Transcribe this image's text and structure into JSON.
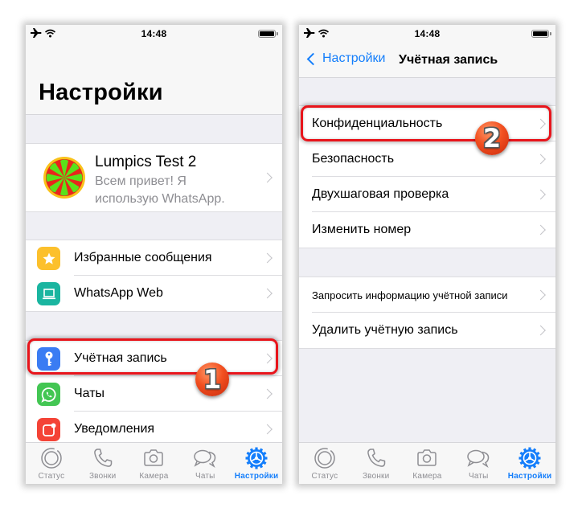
{
  "status_bar": {
    "time": "14:48",
    "icons": [
      "airplane-icon",
      "wifi-icon",
      "battery-icon"
    ]
  },
  "phone1": {
    "title": "Настройки",
    "profile": {
      "name": "Lumpics Test 2",
      "status": "Всем привет! Я использую WhatsApp."
    },
    "group1": [
      {
        "label": "Избранные сообщения",
        "icon": "star-icon",
        "color": "#fcc02c"
      },
      {
        "label": "WhatsApp Web",
        "icon": "laptop-icon",
        "color": "#1ab5a0"
      }
    ],
    "group2": [
      {
        "label": "Учётная запись",
        "icon": "key-icon",
        "color": "#3a7cf3"
      },
      {
        "label": "Чаты",
        "icon": "whatsapp-icon",
        "color": "#43c653"
      },
      {
        "label": "Уведомления",
        "icon": "notification-icon",
        "color": "#f44336"
      }
    ],
    "step_badge": "1"
  },
  "phone2": {
    "back_label": "Настройки",
    "title": "Учётная запись",
    "group1": [
      {
        "label": "Конфиденциальность"
      },
      {
        "label": "Безопасность"
      },
      {
        "label": "Двухшаговая проверка"
      },
      {
        "label": "Изменить номер"
      }
    ],
    "group2": [
      {
        "label": "Запросить информацию учётной записи"
      },
      {
        "label": "Удалить учётную запись"
      }
    ],
    "step_badge": "2"
  },
  "tabbar": {
    "tabs": [
      {
        "label": "Статус",
        "icon": "status-icon",
        "active": false
      },
      {
        "label": "Звонки",
        "icon": "phone-icon",
        "active": false
      },
      {
        "label": "Камера",
        "icon": "camera-icon",
        "active": false
      },
      {
        "label": "Чаты",
        "icon": "chats-icon",
        "active": false
      },
      {
        "label": "Настройки",
        "icon": "settings-icon",
        "active": true
      }
    ]
  },
  "colors": {
    "accent": "#147efb",
    "highlight": "#e8141b",
    "badge": "#f25020"
  }
}
